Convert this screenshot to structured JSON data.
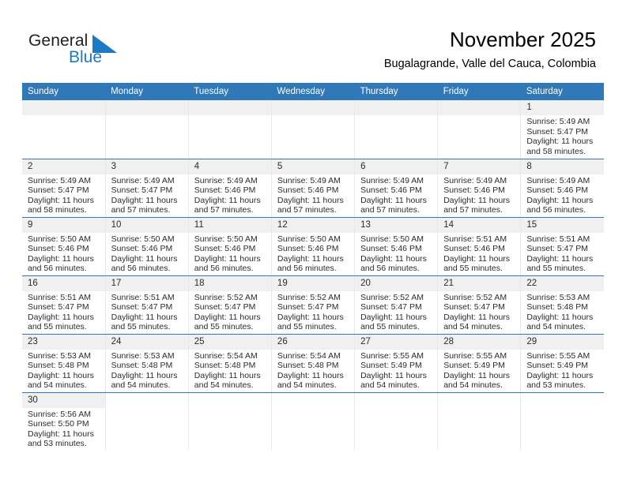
{
  "brand": {
    "name_part1": "General",
    "name_part2": "Blue",
    "flag_icon": "triangle-flag-icon",
    "accent_color": "#1b7ac4"
  },
  "header": {
    "title": "November 2025",
    "subtitle": "Bugalagrande, Valle del Cauca, Colombia",
    "header_bg_color": "#3078b8",
    "daynum_bg_color": "#f0f0f0"
  },
  "weekday_headers": [
    "Sunday",
    "Monday",
    "Tuesday",
    "Wednesday",
    "Thursday",
    "Friday",
    "Saturday"
  ],
  "labels": {
    "sunrise_prefix": "Sunrise:",
    "sunset_prefix": "Sunset:",
    "daylight_prefix": "Daylight:"
  },
  "weeks": [
    [
      {
        "day": "",
        "blank": true,
        "first_row_band": true
      },
      {
        "day": "",
        "blank": true,
        "first_row_band": true
      },
      {
        "day": "",
        "blank": true,
        "first_row_band": true
      },
      {
        "day": "",
        "blank": true,
        "first_row_band": true
      },
      {
        "day": "",
        "blank": true,
        "first_row_band": true
      },
      {
        "day": "",
        "blank": true,
        "first_row_band": true
      },
      {
        "day": "1",
        "sunrise": "Sunrise: 5:49 AM",
        "sunset": "Sunset: 5:47 PM",
        "daylight_line1": "Daylight: 11 hours",
        "daylight_line2": "and 58 minutes."
      }
    ],
    [
      {
        "day": "2",
        "sunrise": "Sunrise: 5:49 AM",
        "sunset": "Sunset: 5:47 PM",
        "daylight_line1": "Daylight: 11 hours",
        "daylight_line2": "and 58 minutes."
      },
      {
        "day": "3",
        "sunrise": "Sunrise: 5:49 AM",
        "sunset": "Sunset: 5:47 PM",
        "daylight_line1": "Daylight: 11 hours",
        "daylight_line2": "and 57 minutes."
      },
      {
        "day": "4",
        "sunrise": "Sunrise: 5:49 AM",
        "sunset": "Sunset: 5:46 PM",
        "daylight_line1": "Daylight: 11 hours",
        "daylight_line2": "and 57 minutes."
      },
      {
        "day": "5",
        "sunrise": "Sunrise: 5:49 AM",
        "sunset": "Sunset: 5:46 PM",
        "daylight_line1": "Daylight: 11 hours",
        "daylight_line2": "and 57 minutes."
      },
      {
        "day": "6",
        "sunrise": "Sunrise: 5:49 AM",
        "sunset": "Sunset: 5:46 PM",
        "daylight_line1": "Daylight: 11 hours",
        "daylight_line2": "and 57 minutes."
      },
      {
        "day": "7",
        "sunrise": "Sunrise: 5:49 AM",
        "sunset": "Sunset: 5:46 PM",
        "daylight_line1": "Daylight: 11 hours",
        "daylight_line2": "and 57 minutes."
      },
      {
        "day": "8",
        "sunrise": "Sunrise: 5:49 AM",
        "sunset": "Sunset: 5:46 PM",
        "daylight_line1": "Daylight: 11 hours",
        "daylight_line2": "and 56 minutes."
      }
    ],
    [
      {
        "day": "9",
        "sunrise": "Sunrise: 5:50 AM",
        "sunset": "Sunset: 5:46 PM",
        "daylight_line1": "Daylight: 11 hours",
        "daylight_line2": "and 56 minutes."
      },
      {
        "day": "10",
        "sunrise": "Sunrise: 5:50 AM",
        "sunset": "Sunset: 5:46 PM",
        "daylight_line1": "Daylight: 11 hours",
        "daylight_line2": "and 56 minutes."
      },
      {
        "day": "11",
        "sunrise": "Sunrise: 5:50 AM",
        "sunset": "Sunset: 5:46 PM",
        "daylight_line1": "Daylight: 11 hours",
        "daylight_line2": "and 56 minutes."
      },
      {
        "day": "12",
        "sunrise": "Sunrise: 5:50 AM",
        "sunset": "Sunset: 5:46 PM",
        "daylight_line1": "Daylight: 11 hours",
        "daylight_line2": "and 56 minutes."
      },
      {
        "day": "13",
        "sunrise": "Sunrise: 5:50 AM",
        "sunset": "Sunset: 5:46 PM",
        "daylight_line1": "Daylight: 11 hours",
        "daylight_line2": "and 56 minutes."
      },
      {
        "day": "14",
        "sunrise": "Sunrise: 5:51 AM",
        "sunset": "Sunset: 5:46 PM",
        "daylight_line1": "Daylight: 11 hours",
        "daylight_line2": "and 55 minutes."
      },
      {
        "day": "15",
        "sunrise": "Sunrise: 5:51 AM",
        "sunset": "Sunset: 5:47 PM",
        "daylight_line1": "Daylight: 11 hours",
        "daylight_line2": "and 55 minutes."
      }
    ],
    [
      {
        "day": "16",
        "sunrise": "Sunrise: 5:51 AM",
        "sunset": "Sunset: 5:47 PM",
        "daylight_line1": "Daylight: 11 hours",
        "daylight_line2": "and 55 minutes."
      },
      {
        "day": "17",
        "sunrise": "Sunrise: 5:51 AM",
        "sunset": "Sunset: 5:47 PM",
        "daylight_line1": "Daylight: 11 hours",
        "daylight_line2": "and 55 minutes."
      },
      {
        "day": "18",
        "sunrise": "Sunrise: 5:52 AM",
        "sunset": "Sunset: 5:47 PM",
        "daylight_line1": "Daylight: 11 hours",
        "daylight_line2": "and 55 minutes."
      },
      {
        "day": "19",
        "sunrise": "Sunrise: 5:52 AM",
        "sunset": "Sunset: 5:47 PM",
        "daylight_line1": "Daylight: 11 hours",
        "daylight_line2": "and 55 minutes."
      },
      {
        "day": "20",
        "sunrise": "Sunrise: 5:52 AM",
        "sunset": "Sunset: 5:47 PM",
        "daylight_line1": "Daylight: 11 hours",
        "daylight_line2": "and 55 minutes."
      },
      {
        "day": "21",
        "sunrise": "Sunrise: 5:52 AM",
        "sunset": "Sunset: 5:47 PM",
        "daylight_line1": "Daylight: 11 hours",
        "daylight_line2": "and 54 minutes."
      },
      {
        "day": "22",
        "sunrise": "Sunrise: 5:53 AM",
        "sunset": "Sunset: 5:48 PM",
        "daylight_line1": "Daylight: 11 hours",
        "daylight_line2": "and 54 minutes."
      }
    ],
    [
      {
        "day": "23",
        "sunrise": "Sunrise: 5:53 AM",
        "sunset": "Sunset: 5:48 PM",
        "daylight_line1": "Daylight: 11 hours",
        "daylight_line2": "and 54 minutes."
      },
      {
        "day": "24",
        "sunrise": "Sunrise: 5:53 AM",
        "sunset": "Sunset: 5:48 PM",
        "daylight_line1": "Daylight: 11 hours",
        "daylight_line2": "and 54 minutes."
      },
      {
        "day": "25",
        "sunrise": "Sunrise: 5:54 AM",
        "sunset": "Sunset: 5:48 PM",
        "daylight_line1": "Daylight: 11 hours",
        "daylight_line2": "and 54 minutes."
      },
      {
        "day": "26",
        "sunrise": "Sunrise: 5:54 AM",
        "sunset": "Sunset: 5:48 PM",
        "daylight_line1": "Daylight: 11 hours",
        "daylight_line2": "and 54 minutes."
      },
      {
        "day": "27",
        "sunrise": "Sunrise: 5:55 AM",
        "sunset": "Sunset: 5:49 PM",
        "daylight_line1": "Daylight: 11 hours",
        "daylight_line2": "and 54 minutes."
      },
      {
        "day": "28",
        "sunrise": "Sunrise: 5:55 AM",
        "sunset": "Sunset: 5:49 PM",
        "daylight_line1": "Daylight: 11 hours",
        "daylight_line2": "and 54 minutes."
      },
      {
        "day": "29",
        "sunrise": "Sunrise: 5:55 AM",
        "sunset": "Sunset: 5:49 PM",
        "daylight_line1": "Daylight: 11 hours",
        "daylight_line2": "and 53 minutes."
      }
    ],
    [
      {
        "day": "30",
        "sunrise": "Sunrise: 5:56 AM",
        "sunset": "Sunset: 5:50 PM",
        "daylight_line1": "Daylight: 11 hours",
        "daylight_line2": "and 53 minutes."
      },
      {
        "day": "",
        "blank": true
      },
      {
        "day": "",
        "blank": true
      },
      {
        "day": "",
        "blank": true
      },
      {
        "day": "",
        "blank": true
      },
      {
        "day": "",
        "blank": true
      },
      {
        "day": "",
        "blank": true
      }
    ]
  ]
}
